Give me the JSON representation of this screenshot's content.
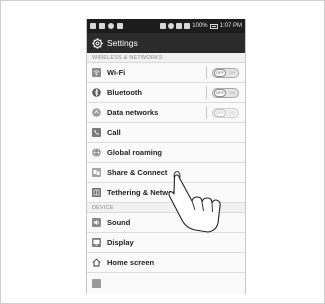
{
  "status_bar": {
    "battery_percent": "100%",
    "time": "1:07 PM"
  },
  "header": {
    "title": "Settings",
    "icon": "gear-icon"
  },
  "sections": {
    "wireless": "WIRELESS & NETWORKS",
    "device": "DEVICE"
  },
  "items": [
    {
      "label": "Wi-Fi",
      "icon": "wifi-icon",
      "toggle": "OFF",
      "toggle_on_text": "ON"
    },
    {
      "label": "Bluetooth",
      "icon": "bluetooth-icon",
      "toggle": "OFF",
      "toggle_on_text": "ON"
    },
    {
      "label": "Data networks",
      "icon": "data-networks-icon",
      "toggle": "OFF",
      "toggle_on_text": "ON"
    },
    {
      "label": "Call",
      "icon": "call-icon"
    },
    {
      "label": "Global roaming",
      "icon": "globe-icon"
    },
    {
      "label": "Share & Connect",
      "icon": "share-connect-icon"
    },
    {
      "label": "Tethering & Networks",
      "icon": "tethering-icon"
    },
    {
      "label": "Sound",
      "icon": "sound-icon"
    },
    {
      "label": "Display",
      "icon": "display-icon"
    },
    {
      "label": "Home screen",
      "icon": "home-icon"
    }
  ],
  "colors": {
    "status_bar": "#1c1c1c",
    "title_bar": "#2b2b2b",
    "list_background": "#fafafa"
  }
}
